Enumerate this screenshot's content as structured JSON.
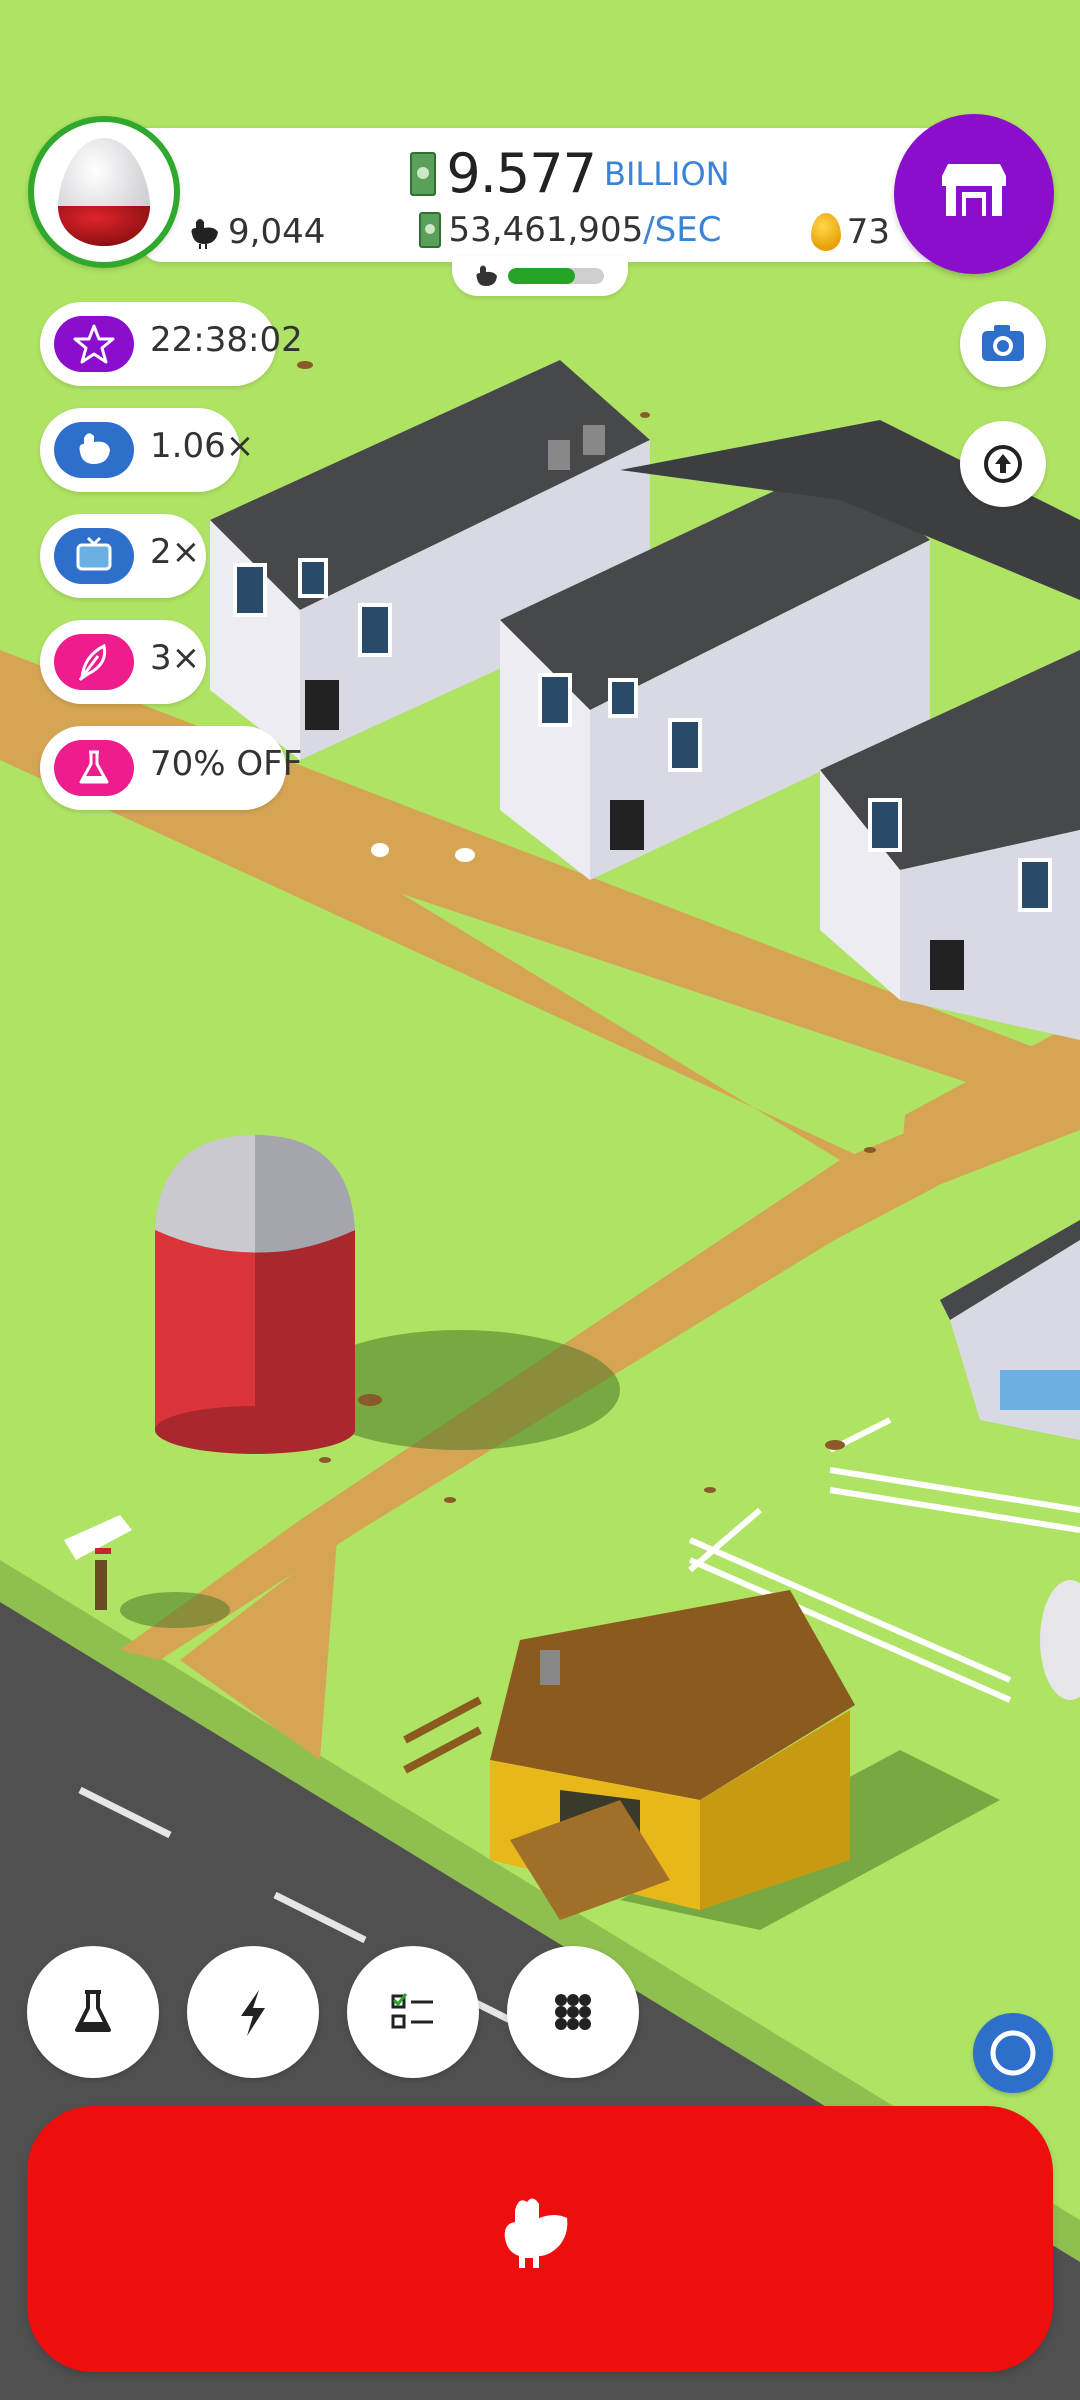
{
  "hud": {
    "money_value": "9.577",
    "money_unit": "BILLION",
    "rate_value": "53,461,905",
    "rate_unit": "/SEC",
    "chicken_count": "9,044",
    "golden_eggs": "73",
    "hatchery_progress": 0.7
  },
  "boosts": [
    {
      "icon": "star-icon",
      "label": "22:38:02",
      "color": "#8b0ecc"
    },
    {
      "icon": "chicken-icon",
      "label": "1.06×",
      "color": "#2f6fcc"
    },
    {
      "icon": "tv-icon",
      "label": "2×",
      "color": "#2f6fcc"
    },
    {
      "icon": "feather-icon",
      "label": "3×",
      "color": "#ef1c8d"
    },
    {
      "icon": "flask-icon",
      "label": "70% OFF",
      "color": "#ef1c8d"
    }
  ],
  "side_buttons": [
    "camera-icon",
    "upload-arrow-icon"
  ],
  "action_buttons": [
    "flask-icon",
    "lightning-icon",
    "checklist-icon",
    "grid-icon"
  ],
  "colors": {
    "grass": "#aee363",
    "path": "#d6a553",
    "road": "#505050",
    "shop": "#8b0ecc",
    "hatch_button": "#ef0e0e",
    "progress": "#27a327"
  }
}
